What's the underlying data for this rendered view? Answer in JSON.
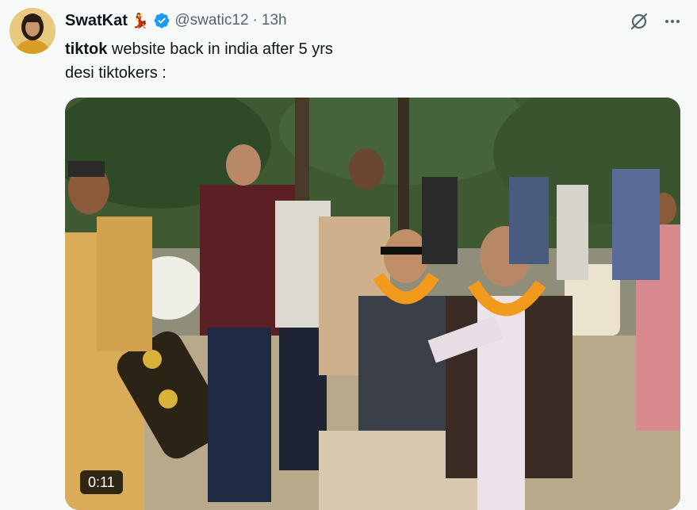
{
  "tweet": {
    "author_name": "SwatKat",
    "author_emoji": "💃",
    "handle": "@swatic12",
    "separator": "·",
    "time": "13h",
    "text_keyword": "tiktok",
    "text_line1_rest": " website back in india after 5 yrs",
    "text_line2": "desi tiktokers :"
  },
  "icons": {
    "verified": "verified-badge-icon",
    "grok": "grok-icon",
    "more": "more-icon"
  },
  "video": {
    "duration": "0:11"
  },
  "colors": {
    "verified_blue": "#1d9bf0",
    "muted_text": "#536471",
    "background": "#f7f9f9"
  }
}
